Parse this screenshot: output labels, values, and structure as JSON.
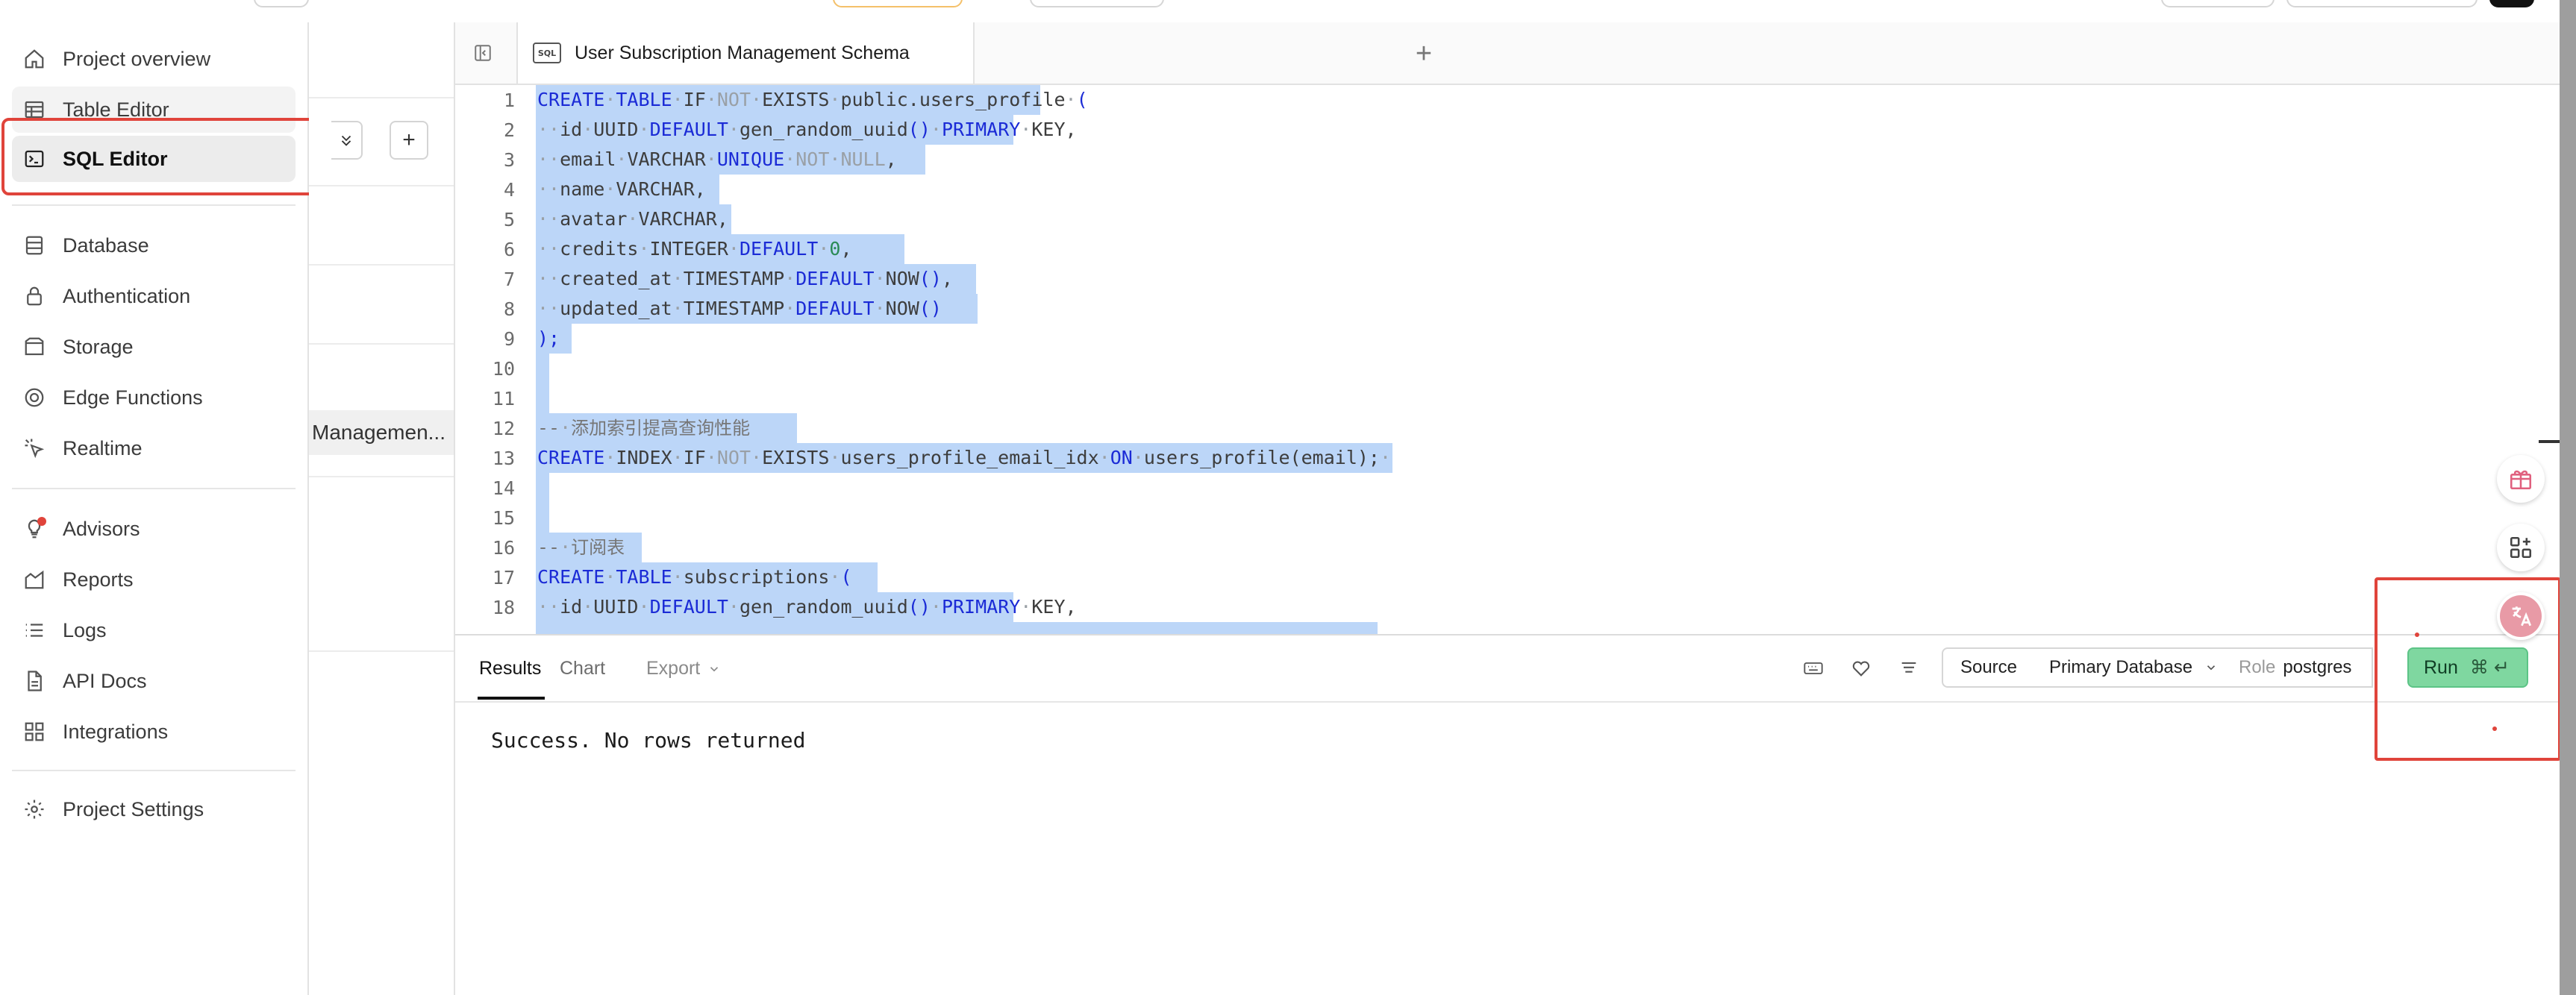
{
  "sidebar": {
    "items": [
      {
        "label": "Project overview",
        "icon": "home-icon"
      },
      {
        "label": "Table Editor",
        "icon": "table-icon"
      },
      {
        "label": "SQL Editor",
        "icon": "terminal-icon"
      },
      {
        "label": "Database",
        "icon": "database-icon"
      },
      {
        "label": "Authentication",
        "icon": "lock-icon"
      },
      {
        "label": "Storage",
        "icon": "archive-icon"
      },
      {
        "label": "Edge Functions",
        "icon": "functions-icon"
      },
      {
        "label": "Realtime",
        "icon": "cursor-click-icon"
      },
      {
        "label": "Advisors",
        "icon": "lightbulb-icon"
      },
      {
        "label": "Reports",
        "icon": "chart-icon"
      },
      {
        "label": "Logs",
        "icon": "list-icon"
      },
      {
        "label": "API Docs",
        "icon": "document-icon"
      },
      {
        "label": "Integrations",
        "icon": "grid-icon"
      },
      {
        "label": "Project Settings",
        "icon": "gear-icon"
      }
    ],
    "active": "SQL Editor"
  },
  "snippets": {
    "current_label": "Managemen..."
  },
  "tabs": {
    "badge": "SQL",
    "active_label": "User Subscription Management Schema",
    "add_label": "+"
  },
  "editor": {
    "lines": [
      {
        "n": "1"
      },
      {
        "n": "2"
      },
      {
        "n": "3"
      },
      {
        "n": "4"
      },
      {
        "n": "5"
      },
      {
        "n": "6"
      },
      {
        "n": "7"
      },
      {
        "n": "8"
      },
      {
        "n": "9"
      },
      {
        "n": "10"
      },
      {
        "n": "11"
      },
      {
        "n": "12"
      },
      {
        "n": "13"
      },
      {
        "n": "14"
      },
      {
        "n": "15"
      },
      {
        "n": "16"
      },
      {
        "n": "17"
      },
      {
        "n": "18"
      }
    ],
    "code": {
      "l1": [
        "CREATE",
        "TABLE",
        "IF",
        "NOT",
        "EXISTS",
        "public.users_profile",
        "("
      ],
      "l2": [
        "id",
        "UUID",
        "DEFAULT",
        "gen_random_uuid",
        "()",
        "PRIMARY",
        "KEY,"
      ],
      "l3": [
        "email",
        "VARCHAR",
        "UNIQUE",
        "NOT",
        "NULL",
        ","
      ],
      "l4": [
        "name",
        "VARCHAR,"
      ],
      "l5": [
        "avatar",
        "VARCHAR,"
      ],
      "l6": [
        "credits",
        "INTEGER",
        "DEFAULT",
        "0",
        ","
      ],
      "l7": [
        "created_at",
        "TIMESTAMP",
        "DEFAULT",
        "NOW",
        "()",
        ","
      ],
      "l8": [
        "updated_at",
        "TIMESTAMP",
        "DEFAULT",
        "NOW",
        "()"
      ],
      "l9": [
        ");"
      ],
      "l12": [
        "--",
        "添加索引提高查询性能"
      ],
      "l13": [
        "CREATE",
        "INDEX",
        "IF",
        "NOT",
        "EXISTS",
        "users_profile_email_idx",
        "ON",
        "users_profile(email);"
      ],
      "l16": [
        "--",
        "订阅表"
      ],
      "l17": [
        "CREATE",
        "TABLE",
        "subscriptions",
        "("
      ],
      "l18": [
        "id",
        "UUID",
        "DEFAULT",
        "gen_random_uuid",
        "()",
        "PRIMARY",
        "KEY,"
      ]
    },
    "selection_color": "#bcd6f8"
  },
  "results": {
    "tabs": [
      "Results",
      "Chart",
      "Export"
    ],
    "active_tab": "Results",
    "source_label": "Source",
    "database_label": "Primary Database",
    "role_prefix": "Role",
    "role_value": "postgres",
    "run_label": "Run",
    "run_shortcut": "⌘ ↵",
    "message": "Success. No rows returned"
  },
  "colors": {
    "annotation_red": "#e0443b",
    "run_green": "#7fd7a0",
    "keyword_blue": "#1b2bd6"
  }
}
